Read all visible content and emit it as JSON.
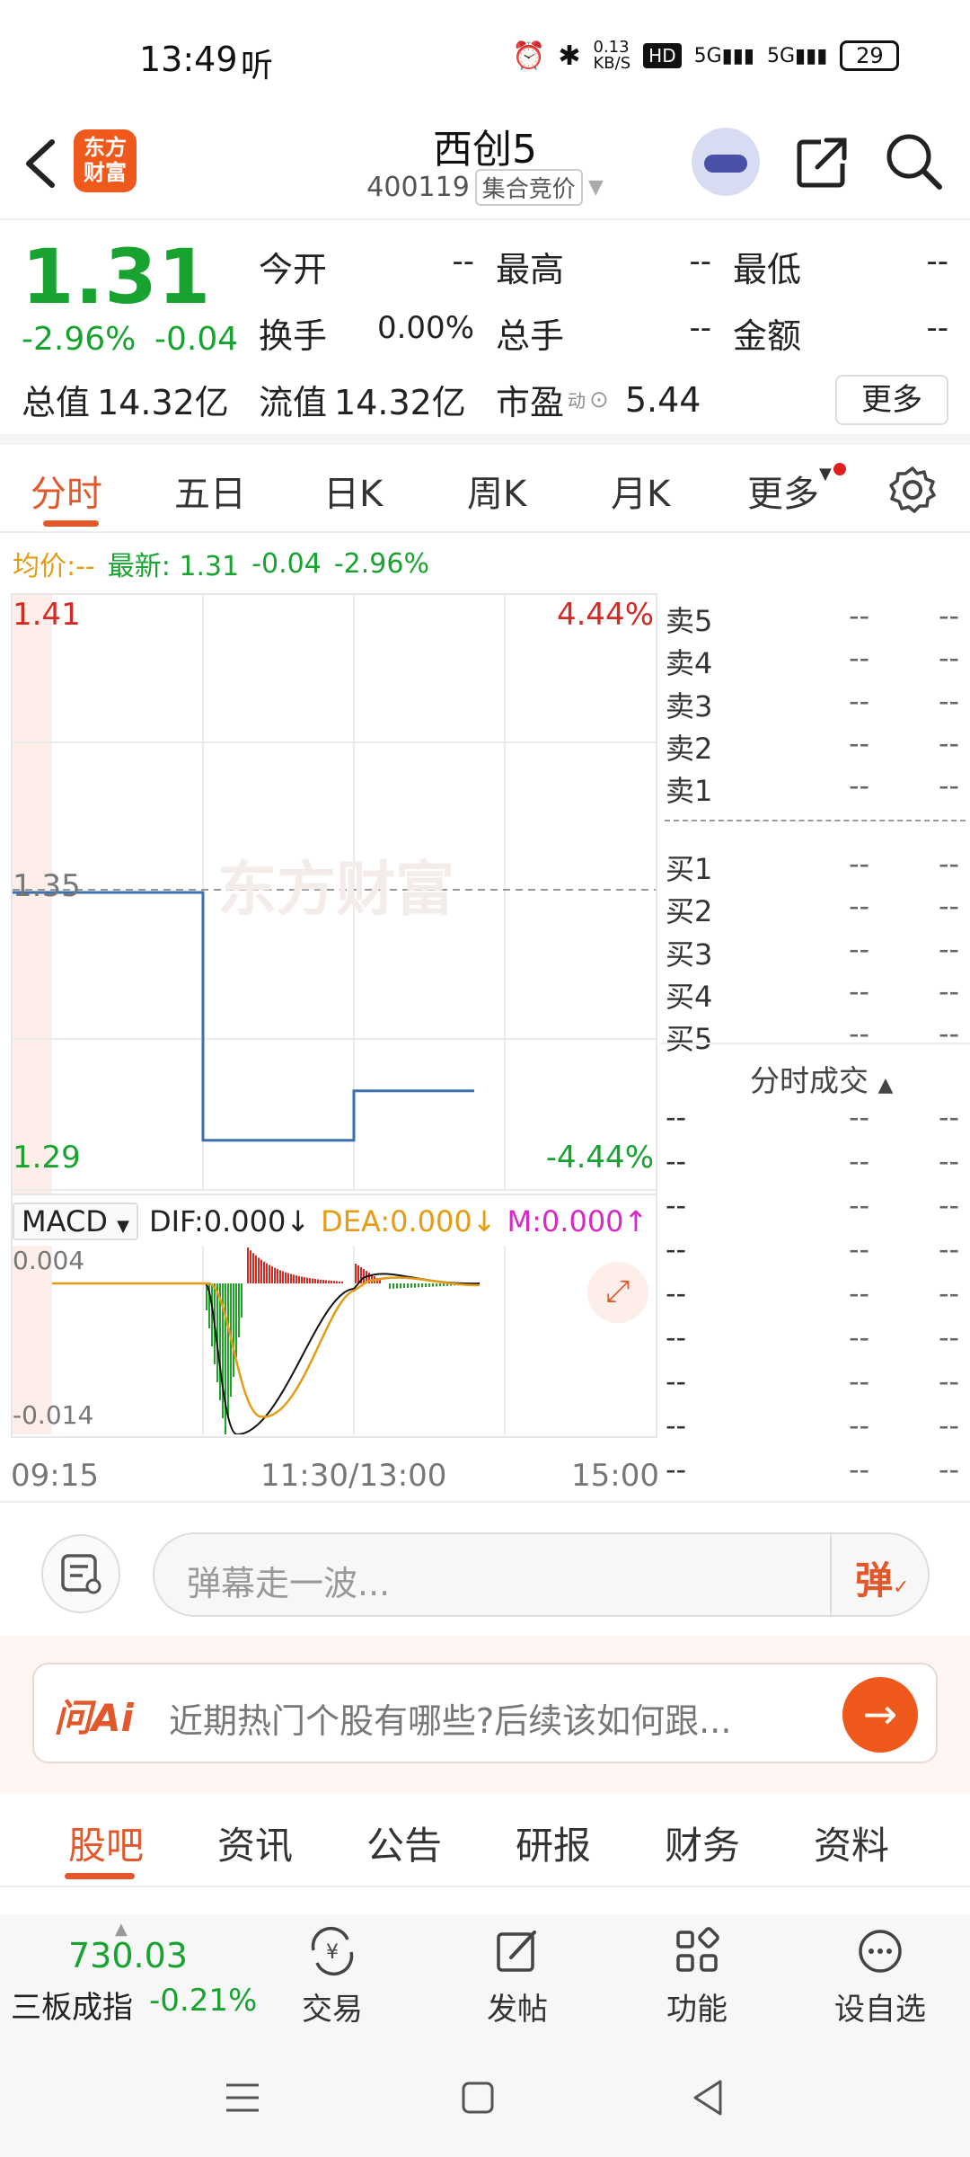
{
  "status_bar": {
    "time": "13:49",
    "ear_icon": "听",
    "net_speed": "0.13\nKB/S",
    "hd": "HD",
    "sig1": "5G",
    "sig2": "5G",
    "battery": "29"
  },
  "header": {
    "logo_text": "东方\n财富",
    "name": "西创5",
    "code": "400119",
    "session_tag": "集合竞价"
  },
  "quote": {
    "price": "1.31",
    "change_pct": "-2.96%",
    "change": "-0.04",
    "open_label": "今开",
    "open_value": "--",
    "high_label": "最高",
    "high_value": "--",
    "low_label": "最低",
    "low_value": "--",
    "turnover_label": "换手",
    "turnover_value": "0.00%",
    "volume_label": "总手",
    "volume_value": "--",
    "amount_label": "金额",
    "amount_value": "--",
    "mcap_label": "总值",
    "mcap_value": "14.32亿",
    "float_label": "流值",
    "float_value": "14.32亿",
    "pe_label": "市盈",
    "pe_sup": "动",
    "pe_value": "5.44",
    "more_label": "更多"
  },
  "chart_tabs": [
    "分时",
    "五日",
    "日K",
    "周K",
    "月K",
    "更多"
  ],
  "avg_line": {
    "avg_label": "均价:",
    "avg_value": "--",
    "latest_label": "最新:",
    "latest_value": "1.31",
    "chg": "-0.04",
    "pct": "-2.96%"
  },
  "chart": {
    "y_high": "1.41",
    "y_mid": "1.35",
    "y_low": "1.29",
    "pct_high": "4.44%",
    "pct_low": "-4.44%",
    "macd_label": "MACD",
    "dif": "DIF:0.000",
    "dea": "DEA:0.000",
    "m": "M:0.000",
    "macd_top": "0.004",
    "macd_bottom": "-0.014",
    "t_start": "09:15",
    "t_mid": "11:30/13:00",
    "t_end": "15:00",
    "watermark": "东方财富"
  },
  "chart_data": {
    "type": "line",
    "title": "",
    "x": [
      "09:15",
      "09:25",
      "09:25",
      "09:35",
      "09:35",
      "09:41"
    ],
    "series": [
      {
        "values": [
          1.35,
          1.35,
          1.3,
          1.3,
          1.31,
          1.31
        ]
      }
    ],
    "ylim": [
      1.29,
      1.41
    ],
    "y_ticks": [
      "1.41",
      "1.35",
      "1.29"
    ],
    "x_ticks": [
      "09:15",
      "11:30/13:00",
      "15:00"
    ],
    "grid": true,
    "colors": {
      "price": "#3a6fb0"
    }
  },
  "order_book": {
    "asks": [
      {
        "label": "卖5",
        "price": "--",
        "vol": "--"
      },
      {
        "label": "卖4",
        "price": "--",
        "vol": "--"
      },
      {
        "label": "卖3",
        "price": "--",
        "vol": "--"
      },
      {
        "label": "卖2",
        "price": "--",
        "vol": "--"
      },
      {
        "label": "卖1",
        "price": "--",
        "vol": "--"
      }
    ],
    "bids": [
      {
        "label": "买1",
        "price": "--",
        "vol": "--"
      },
      {
        "label": "买2",
        "price": "--",
        "vol": "--"
      },
      {
        "label": "买3",
        "price": "--",
        "vol": "--"
      },
      {
        "label": "买4",
        "price": "--",
        "vol": "--"
      },
      {
        "label": "买5",
        "price": "--",
        "vol": "--"
      }
    ],
    "ticks_title": "分时成交",
    "ticks": [
      {
        "t": "--",
        "p": "--",
        "v": "--"
      },
      {
        "t": "--",
        "p": "--",
        "v": "--"
      },
      {
        "t": "--",
        "p": "--",
        "v": "--"
      },
      {
        "t": "--",
        "p": "--",
        "v": "--"
      },
      {
        "t": "--",
        "p": "--",
        "v": "--"
      },
      {
        "t": "--",
        "p": "--",
        "v": "--"
      },
      {
        "t": "--",
        "p": "--",
        "v": "--"
      },
      {
        "t": "--",
        "p": "--",
        "v": "--"
      },
      {
        "t": "--",
        "p": "--",
        "v": "--"
      }
    ]
  },
  "comment_bar": {
    "placeholder": "弹幕走一波...",
    "danmaku_btn": "弹"
  },
  "ai_bar": {
    "logo": "问Ai",
    "prompt": "近期热门个股有哪些?后续该如何跟..."
  },
  "bottom_tabs": [
    "股吧",
    "资讯",
    "公告",
    "研报",
    "财务",
    "资料"
  ],
  "footer": {
    "index_value": "730.03",
    "index_name": "三板成指",
    "index_change": "-0.21%",
    "buttons": [
      "交易",
      "发帖",
      "功能",
      "设自选"
    ]
  },
  "colors": {
    "accent": "#e3582a",
    "up": "#d52a24",
    "down": "#18a331",
    "price_line": "#3a6fb0"
  }
}
